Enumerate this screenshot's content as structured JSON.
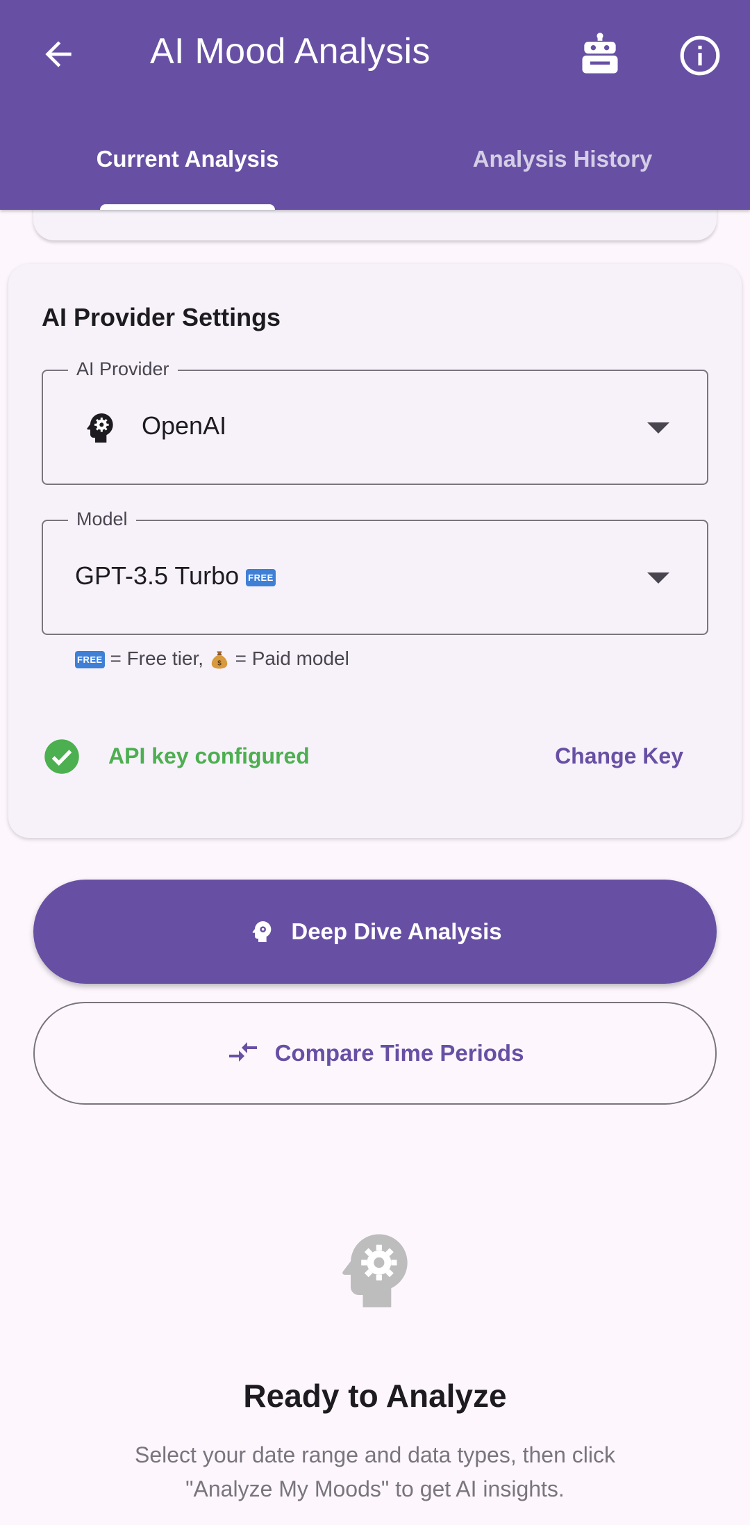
{
  "appbar": {
    "title": "AI Mood Analysis",
    "icons": [
      "arrow-back-icon",
      "robot-icon",
      "info-icon"
    ]
  },
  "tabs": [
    {
      "label": "Current Analysis",
      "active": true
    },
    {
      "label": "Analysis History",
      "active": false
    }
  ],
  "settings": {
    "title": "AI Provider Settings",
    "provider": {
      "label": "AI Provider",
      "value": "OpenAI",
      "icon": "psychology-icon"
    },
    "model": {
      "label": "Model",
      "value": "GPT-3.5 Turbo",
      "badge": "FREE"
    },
    "helper": {
      "free_badge": "FREE",
      "free_text": " = Free tier, ",
      "paid_text": " = Paid model"
    },
    "api_status": "API key configured",
    "change_key": "Change Key"
  },
  "actions": {
    "deep_dive": "Deep Dive Analysis",
    "compare": "Compare Time Periods"
  },
  "empty_state": {
    "title": "Ready to Analyze",
    "description": "Select your date range and data types, then click \"Analyze My Moods\" to get AI insights."
  },
  "colors": {
    "primary": "#6750a4",
    "success": "#4caf50",
    "surface": "#f7f2fa",
    "background": "#fdf7fd"
  }
}
